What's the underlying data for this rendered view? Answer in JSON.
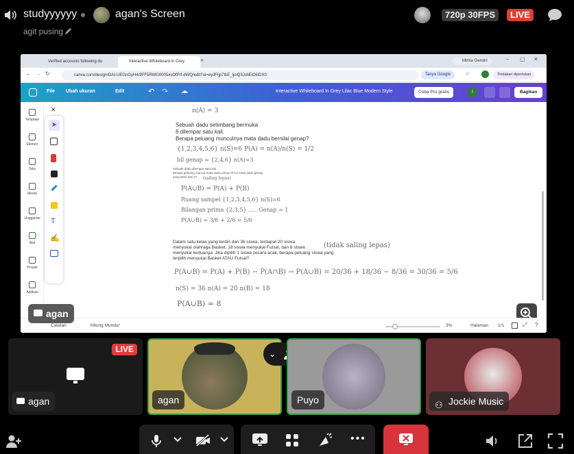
{
  "top_bar": {
    "room_name": "studyyyyyy",
    "screen_title": "agan's Screen",
    "status": "agit pusing",
    "quality": "720p 30FPS",
    "live_badge": "LIVE"
  },
  "browser": {
    "tabs": [
      "Verified accounts following du",
      "Interactive Whiteboard in Grey"
    ],
    "profile_chip": "Mimia Gemini",
    "url": "canva.com/design/DAI-UEGnGyH4/9FF5RWG0005xsOfPrf-dWQ/edit?ui=eyJFIjp7IkE_ljoiQ3JsIiEiOiIiDX0",
    "assist": "Tanya Google",
    "help_chip": "Tindakan diperlukan"
  },
  "canva": {
    "menu": [
      "File",
      "Ubah ukuran",
      "Edit"
    ],
    "title": "Interactive Whiteboard In Grey Lilac Blue Modern Style",
    "pro": "Coba Pro gratis",
    "user_initial": "I",
    "share": "Bagikan",
    "rail": [
      "Template",
      "Elemen",
      "Teks",
      "Merek",
      "Unggahan",
      "Alat",
      "Proyek",
      "Aplikasi"
    ],
    "status_bar": {
      "notes": "Catatan",
      "timer": "Hitung Mundur",
      "zoom": "3%",
      "page_label": "Halaman",
      "page": "1/1"
    }
  },
  "whiteboard": {
    "problem1": [
      "Sebuah dadu setimbang bermuka",
      "6 dilempar satu kali.",
      "Berapa peluang munculnya mata dadu bernilai genap?"
    ],
    "problem2": [
      "Sebuah dadu dilempar satu kali.",
      "Berapa peluang muncul mata dadu prima ATAU mata dadu genap",
      "yang lebih dari 4?"
    ],
    "problem3": [
      "Dalam satu kelas yang terdiri dari 36 siswa, terdapat 20 siswa",
      "menyukai olahraga Basket, 18 siswa menyukai Futsal, dan 8 siswa",
      "menyukai keduanya. Jika dipilih 1 siswa secara acak, berapa peluang siswa yang",
      "terpilih menyukai Basket ATAU Futsal?"
    ],
    "handwriting": [
      "n(A) = 3",
      "{1,2,3,4,5,6}  n(S)=6   P(A) = n(A)/n(S) = 1/2",
      "bil genap = {2,4,6}  n(A)=3",
      "(saling lepas)",
      "P(A∪B) = P(A) + P(B)",
      "Ruang sampel {1,2,3,4,5,6}  n(S)=6",
      "Bilangan prima {2,3,5}  .....  Genap = 1",
      "P(A∪B) = 3/6 + 2/6 = 5/6",
      "(tidak saling lepas)",
      "P(A∪B) = P(A) + P(B) − P(A∩B) → P(A∪B) = 20/36 + 18/36 − 8/36 = 30/36 = 5/6",
      "n(S) = 36   n(A) = 20   n(B) = 18",
      "P(A∪B) = 8"
    ]
  },
  "presenter_label": "agan",
  "participants": [
    {
      "name": "agan",
      "live": "LIVE"
    },
    {
      "name": "agan"
    },
    {
      "name": "Puyo"
    },
    {
      "name": "Jockie Music"
    }
  ],
  "colors": {
    "live": "#e23b3b",
    "speaking_border": "#2ea043",
    "end_call": "#d8343b"
  }
}
